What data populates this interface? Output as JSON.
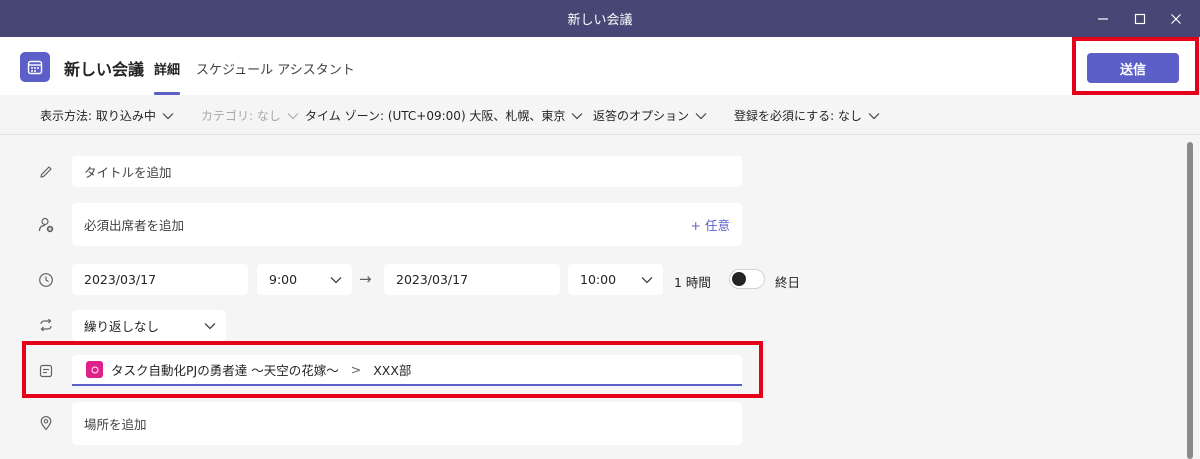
{
  "window": {
    "title": "新しい会議",
    "minimize_glyph": "—",
    "maximize_glyph": "☐",
    "close_glyph": "✕"
  },
  "header": {
    "meeting_title": "新しい会議",
    "tabs": [
      {
        "label": "詳細",
        "active": true
      },
      {
        "label": "スケジュール アシスタント",
        "active": false
      }
    ],
    "send_label": "送信"
  },
  "options": {
    "show_as": "表示方法: 取り込み中",
    "category": "カテゴリ: なし",
    "time_zone": "タイム ゾーン: (UTC+09:00) 大阪、札幌、東京",
    "response_options": "返答のオプション",
    "registration": "登録を必須にする: なし"
  },
  "form": {
    "title_placeholder": "タイトルを追加",
    "attendees_placeholder": "必須出席者を追加",
    "optional_link": "+ 任意",
    "start_date": "2023/03/17",
    "start_time": "9:00",
    "arrow": "→",
    "end_date": "2023/03/17",
    "end_time": "10:00",
    "duration": "1 時間",
    "all_day_label": "終日",
    "all_day_on": false,
    "repeat": "繰り返しなし",
    "channel": {
      "team": "タスク自動化PJの勇者達 〜天空の花嫁〜",
      "separator": ">",
      "channel_name": "XXX部"
    },
    "location_placeholder": "場所を追加"
  },
  "colors": {
    "titlebar": "#464775",
    "accent": "#5b5fc7",
    "highlight": "#e6001a",
    "team_avatar": "#e0218a"
  }
}
